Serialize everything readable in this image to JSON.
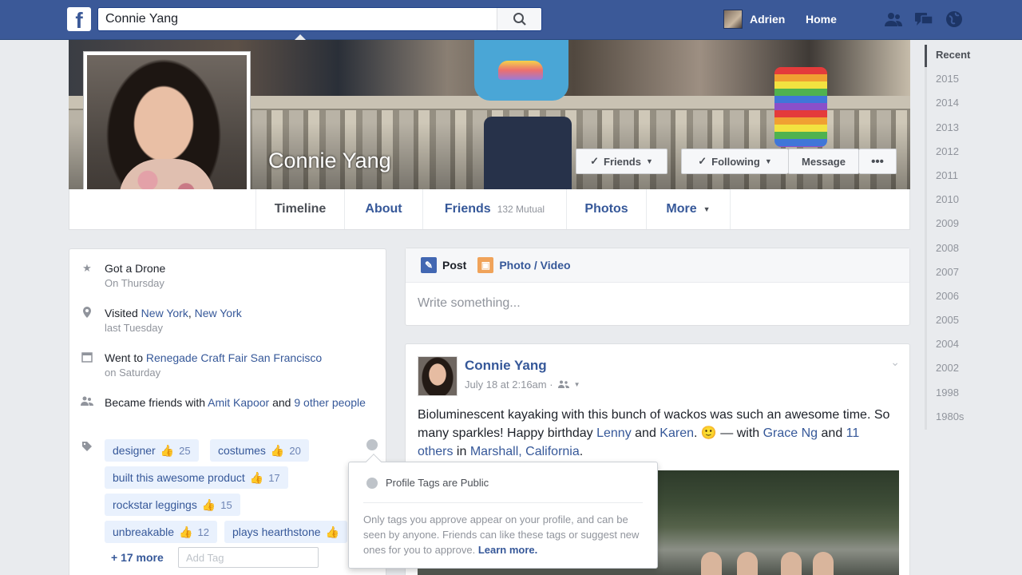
{
  "topbar": {
    "logo": "f",
    "search_value": "Connie Yang",
    "user_name": "Adrien",
    "home_label": "Home",
    "icons": [
      "friend-requests-icon",
      "messages-icon",
      "notifications-globe-icon"
    ]
  },
  "cover": {
    "name": "Connie Yang",
    "friends_btn": "Friends",
    "following_btn": "Following",
    "message_btn": "Message",
    "more_btn": "•••"
  },
  "tabs": [
    {
      "label": "Timeline"
    },
    {
      "label": "About"
    },
    {
      "label": "Friends",
      "sub": "132 Mutual"
    },
    {
      "label": "Photos"
    },
    {
      "label": "More"
    }
  ],
  "years": [
    "Recent",
    "2015",
    "2014",
    "2013",
    "2012",
    "2011",
    "2010",
    "2009",
    "2008",
    "2007",
    "2006",
    "2005",
    "2004",
    "2002",
    "1998",
    "1980s"
  ],
  "life_events": [
    {
      "icon": "star-icon",
      "text": "Got a Drone",
      "sub": "On Thursday"
    },
    {
      "icon": "location-pin-icon",
      "prefix": "Visited ",
      "link1": "New York",
      "sep": ", ",
      "link2": "New York",
      "sub": "last Tuesday"
    },
    {
      "icon": "calendar-icon",
      "prefix": "Went to ",
      "link1": "Renegade Craft Fair San Francisco",
      "sub": "on Saturday"
    },
    {
      "icon": "friends-icon",
      "prefix": "Became friends with ",
      "link1": "Amit Kapoor",
      "mid": " and ",
      "link2": "9 other people"
    }
  ],
  "tags": [
    {
      "label": "designer",
      "count": "25"
    },
    {
      "label": "costumes",
      "count": "20"
    },
    {
      "label": "built this awesome product",
      "count": "17"
    },
    {
      "label": "rockstar leggings",
      "count": "15"
    },
    {
      "label": "unbreakable",
      "count": "12"
    },
    {
      "label": "plays hearthstone",
      "count": ""
    }
  ],
  "more_tags": "+ 17 more",
  "add_tag_placeholder": "Add Tag",
  "composer": {
    "post_label": "Post",
    "photo_label": "Photo / Video",
    "placeholder": "Write something..."
  },
  "post": {
    "author": "Connie Yang",
    "time": "July 18 at 2:16am ·",
    "text_1": "Bioluminescent kayaking with this bunch of wackos was such an awesome time. So many sparkles! Happy birthday ",
    "link_lenny": "Lenny",
    "and_1": " and ",
    "link_karen": "Karen",
    "text_2": ". 🙂 — with ",
    "link_grace": "Grace Ng",
    "and_2": " and ",
    "link_others": "11 others",
    "in": " in ",
    "link_marshall": "Marshall, California",
    "end": "."
  },
  "popover": {
    "title": "Profile Tags are Public",
    "body": "Only tags you approve appear on your profile, and can be seen by anyone. Friends can like these tags or suggest new ones for you to approve.",
    "link": "Learn more."
  }
}
